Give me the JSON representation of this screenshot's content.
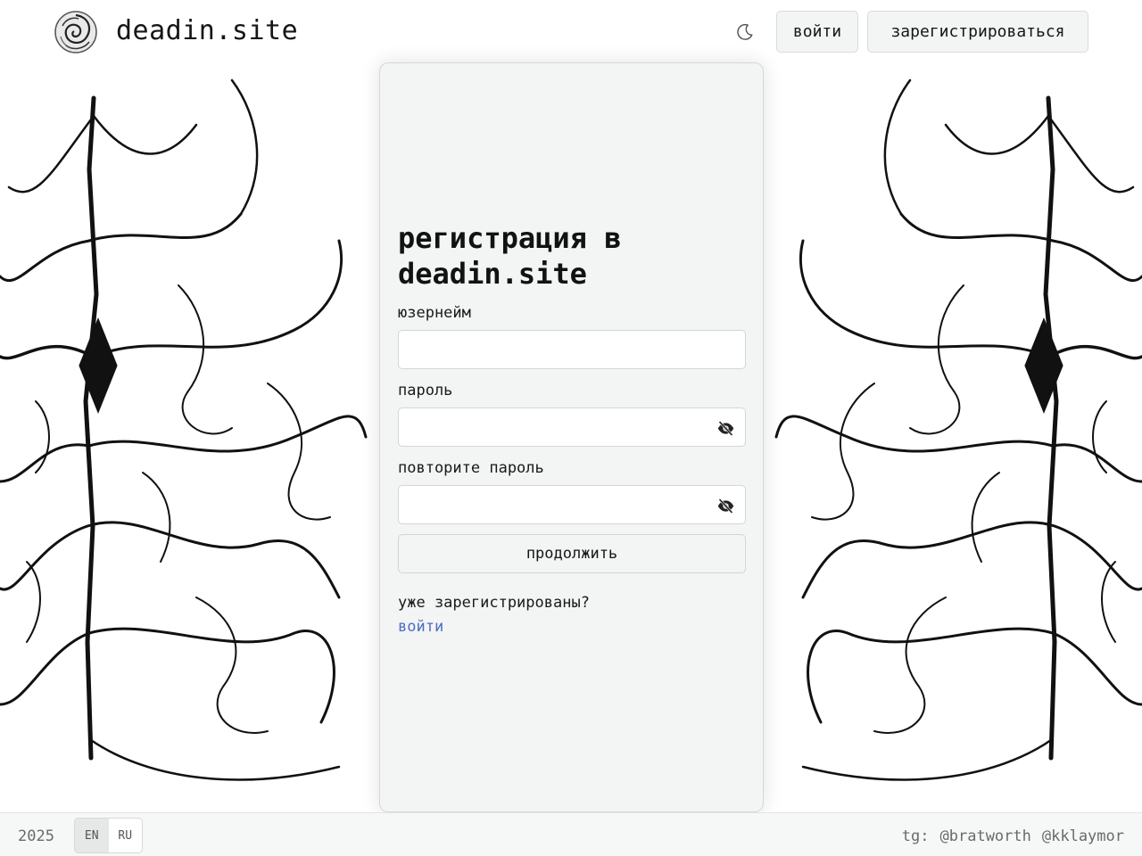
{
  "header": {
    "brand": "deadin.site",
    "login_label": "войти",
    "register_label": "зарегистрироваться",
    "theme_icon": "moon-icon"
  },
  "form": {
    "title": "регистрация в deadin.site",
    "username_label": "юзернейм",
    "username_value": "",
    "password_label": "пароль",
    "password_value": "",
    "repeat_label": "повторите пароль",
    "repeat_value": "",
    "visibility_icon": "eye-off-icon",
    "submit_label": "продолжить",
    "already_text": "уже зарегистрированы?",
    "login_link": "войти"
  },
  "footer": {
    "year": "2025",
    "langs": [
      "EN",
      "RU"
    ],
    "active_lang": "RU",
    "contacts_prefix": "tg:",
    "contacts": [
      "@bratworth",
      "@kklaymor"
    ]
  },
  "colors": {
    "link": "#4b6fc2",
    "card_bg": "#f3f4f4",
    "text": "#161616"
  }
}
